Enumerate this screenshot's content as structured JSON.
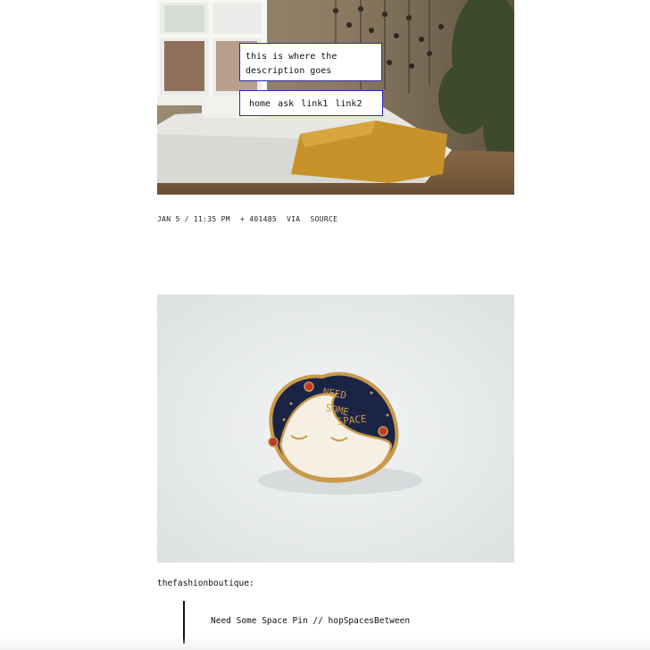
{
  "header": {
    "description": "this is where the description goes",
    "nav": [
      "home",
      "ask",
      "link1",
      "link2"
    ]
  },
  "post1": {
    "image_alt": "bedroom with mattress on floor and mustard blanket",
    "date": "JAN 5 / 11:35 PM",
    "notes": "+ 401485",
    "via_label": "VIA",
    "source_label": "SOURCE"
  },
  "post2": {
    "image_alt": "enamel pin: Need Some Space",
    "pin_text": [
      "NEED",
      "SOME",
      "SPACE"
    ],
    "reblog_user": "thefashionboutique:",
    "quote": "Need Some Space Pin // hopSpacesBetween"
  },
  "colors": {
    "border_accent": "#2a2ab8",
    "pin_navy": "#1c2446",
    "pin_gold": "#c89a4a",
    "blanket": "#c8922a"
  }
}
